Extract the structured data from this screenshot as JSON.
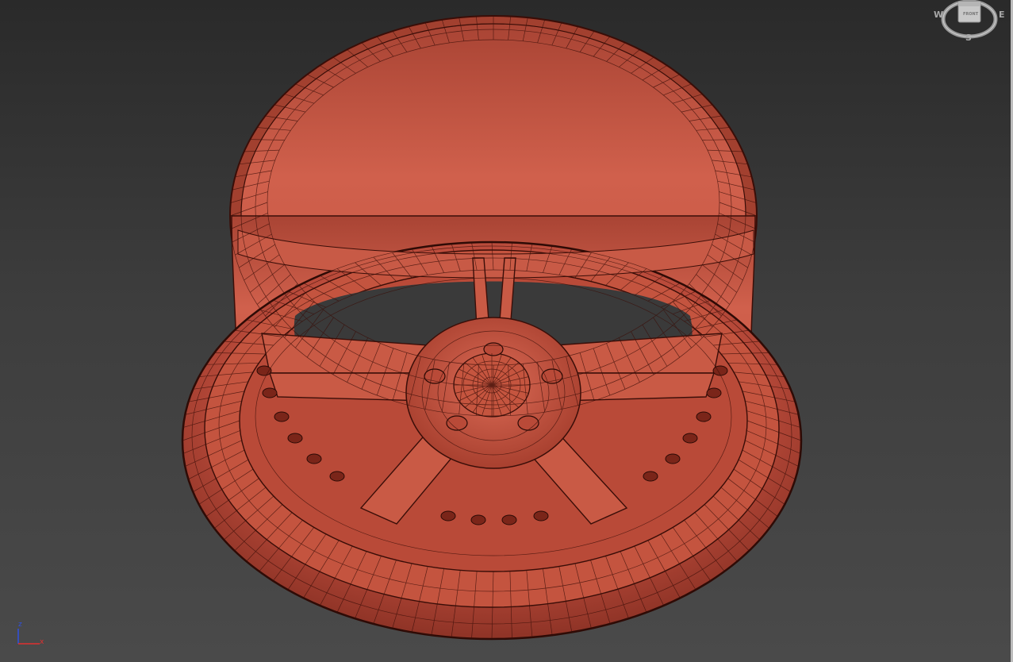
{
  "viewport": {
    "background_top": "#2a2a2a",
    "background_bottom": "#4a4a4a",
    "model_color": "#c0503f",
    "wire_color": "#3a0e08"
  },
  "viewcube": {
    "face_label": "FRONT",
    "compass_w": "W",
    "compass_e": "E",
    "compass_s": "S"
  },
  "axis_gizmo": {
    "z_label": "z",
    "x_label": "x",
    "z_color": "#3050e0",
    "x_color": "#e03030"
  }
}
